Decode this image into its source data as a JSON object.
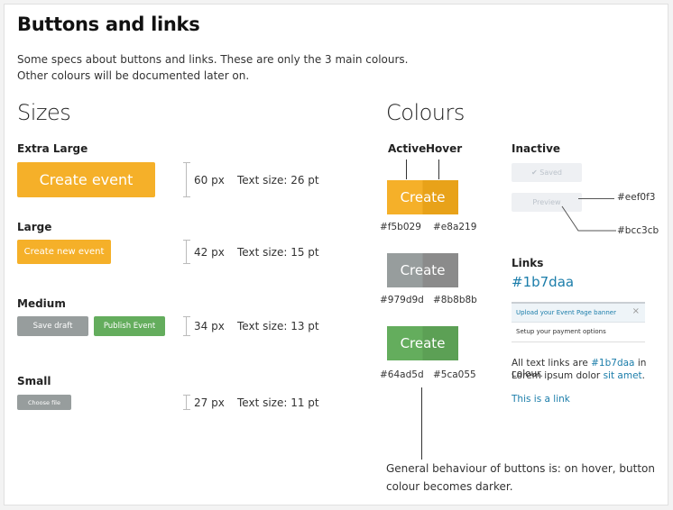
{
  "title": "Buttons and links",
  "intro": [
    "Some specs about buttons and links. These are only the 3 main colours.",
    "Other colours will be documented later on."
  ],
  "sizes": {
    "heading": "Sizes",
    "xl": {
      "label": "Extra Large",
      "button": "Create event",
      "px": "60 px",
      "text": "Text size: 26 pt"
    },
    "l": {
      "label": "Large",
      "button": "Create new event",
      "px": "42 px",
      "text": "Text size: 15 pt"
    },
    "m": {
      "label": "Medium",
      "button1": "Save draft",
      "button2": "Publish Event",
      "px": "34 px",
      "text": "Text size: 13 pt"
    },
    "s": {
      "label": "Small",
      "button": "Choose file",
      "px": "27 px",
      "text": "Text size: 11 pt"
    }
  },
  "colours": {
    "heading": "Colours",
    "active_label": "Active",
    "hover_label": "Hover",
    "button_label": "Create",
    "orange": {
      "active": "#f5b029",
      "hover": "#e8a219"
    },
    "grey": {
      "active": "#979d9d",
      "hover": "#8b8b8b"
    },
    "green": {
      "active": "#64ad5d",
      "hover": "#5ca055"
    },
    "note": [
      "General behaviour of buttons is: on hover, button",
      "colour becomes darker."
    ]
  },
  "inactive": {
    "heading": "Inactive",
    "saved": "✔ Saved",
    "preview": "Preview",
    "bg_hex": "#eef0f3",
    "text_hex": "#bcc3cb"
  },
  "links": {
    "heading": "Links",
    "color": "#1b7daa",
    "banner_item": "Upload your Event Page banner",
    "banner_close": "×",
    "payment_item": "Setup your payment options",
    "desc_prefix": "All text links are ",
    "desc_color": "#1b7daa",
    "desc_mid": " in colour.",
    "desc_line2": "Lorem ipsum dolor ",
    "desc_link": "sit amet",
    "desc_end": ".",
    "example": "This is a link"
  }
}
